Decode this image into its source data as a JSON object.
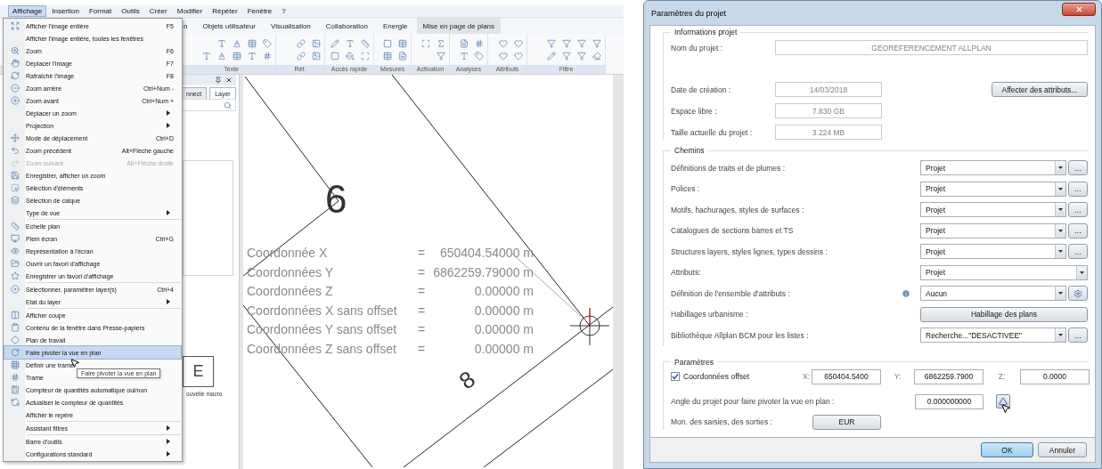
{
  "menubar": [
    {
      "label": "Affichage",
      "selected": true
    },
    {
      "label": "Insertion",
      "selected": false
    },
    {
      "label": "Format",
      "selected": false
    },
    {
      "label": "Outils",
      "selected": false
    },
    {
      "label": "Créer",
      "selected": false
    },
    {
      "label": "Modifier",
      "selected": false
    },
    {
      "label": "Répéter",
      "selected": false
    },
    {
      "label": "Fenêtre",
      "selected": false
    },
    {
      "label": "?",
      "selected": false
    }
  ],
  "ribbon": {
    "tabs": [
      {
        "label": "n",
        "selected": false
      },
      {
        "label": "Objets utilisateur",
        "selected": false
      },
      {
        "label": "Visualisation",
        "selected": false
      },
      {
        "label": "Collaboration",
        "selected": false
      },
      {
        "label": "Energie",
        "selected": false
      },
      {
        "label": "Mise en page de plans",
        "selected": true
      }
    ],
    "groups": [
      {
        "label": "Texte"
      },
      {
        "label": "Réf."
      },
      {
        "label": "Accès rapide"
      },
      {
        "label": "Mesures"
      },
      {
        "label": "Activation"
      },
      {
        "label": "Analyses"
      },
      {
        "label": "Attributs"
      },
      {
        "label": "Filtre"
      }
    ]
  },
  "menu": {
    "sections": [
      {
        "items": [
          {
            "kind": "command",
            "label": "Afficher l'image entière",
            "shortcut": "F5",
            "selected": false,
            "disabled": false
          },
          {
            "kind": "command",
            "label": "Afficher l'image entière, toutes les fenêtres",
            "selected": false,
            "disabled": false
          },
          {
            "kind": "command",
            "label": "Zoom",
            "shortcut": "F6",
            "selected": false,
            "disabled": false
          },
          {
            "kind": "command",
            "label": "Déplacer l'image",
            "shortcut": "F7",
            "selected": false,
            "disabled": false
          },
          {
            "kind": "command",
            "label": "Rafraîchir l'image",
            "shortcut": "F8",
            "selected": false,
            "disabled": false
          },
          {
            "kind": "command",
            "label": "Zoom arrière",
            "shortcut": "Ctrl+Num -",
            "selected": false,
            "disabled": false
          },
          {
            "kind": "command",
            "label": "Zoom avant",
            "shortcut": "Ctrl+Num +",
            "selected": false,
            "disabled": false
          },
          {
            "kind": "submenu",
            "label": "Déplacer un zoom",
            "selected": false,
            "disabled": false
          },
          {
            "kind": "submenu",
            "label": "Projection",
            "selected": false,
            "disabled": false
          },
          {
            "kind": "command",
            "label": "Mode de déplacement",
            "shortcut": "Ctrl+D",
            "selected": false,
            "disabled": false
          },
          {
            "kind": "command",
            "label": "Zoom précédent",
            "shortcut": "Alt+Flèche gauche",
            "selected": false,
            "disabled": false
          },
          {
            "kind": "command",
            "label": "Zoom suivant",
            "shortcut": "Alt+Flèche droite",
            "selected": false,
            "disabled": true
          },
          {
            "kind": "command",
            "label": "Enregistrer, afficher un zoom",
            "selected": false,
            "disabled": false
          },
          {
            "kind": "command",
            "label": "Sélection d'éléments",
            "selected": false,
            "disabled": false
          },
          {
            "kind": "command",
            "label": "Sélection de calque",
            "selected": false,
            "disabled": false
          },
          {
            "kind": "submenu",
            "label": "Type de vue",
            "selected": false,
            "disabled": false
          }
        ]
      },
      {
        "items": [
          {
            "kind": "command",
            "label": "Echelle plan",
            "selected": false,
            "disabled": false
          },
          {
            "kind": "command",
            "label": "Plein écran",
            "shortcut": "Ctrl+G",
            "selected": false,
            "disabled": false
          },
          {
            "kind": "command",
            "label": "Représentation à l'écran",
            "selected": false,
            "disabled": false
          },
          {
            "kind": "command",
            "label": "Ouvrir un favori d'affichage",
            "selected": false,
            "disabled": false
          },
          {
            "kind": "command",
            "label": "Enregistrer un favori d'affichage",
            "selected": false,
            "disabled": false
          }
        ]
      },
      {
        "items": [
          {
            "kind": "command",
            "label": "Sélectionner, paramétrer layer(s)",
            "shortcut": "Ctrl+4",
            "selected": false,
            "disabled": false
          },
          {
            "kind": "submenu",
            "label": "Etat du layer",
            "selected": false,
            "disabled": false
          }
        ]
      },
      {
        "items": [
          {
            "kind": "command",
            "label": "Afficher coupe",
            "selected": false,
            "disabled": false
          },
          {
            "kind": "command",
            "label": "Contenu de la fenêtre dans Presse-papiers",
            "selected": false,
            "disabled": false
          },
          {
            "kind": "command",
            "label": "Plan de travail",
            "selected": false,
            "disabled": false
          },
          {
            "kind": "command",
            "label": "Faire pivoter la vue en plan",
            "selected": true,
            "disabled": false
          },
          {
            "kind": "command",
            "label": "Définir une trame",
            "selected": false,
            "disabled": false
          },
          {
            "kind": "command",
            "label": "Trame",
            "selected": false,
            "disabled": false
          },
          {
            "kind": "command",
            "label": "Compteur de quantités automatique oui/non",
            "selected": false,
            "disabled": false
          },
          {
            "kind": "command",
            "label": "Actualiser le compteur de quantités",
            "selected": false,
            "disabled": false
          },
          {
            "kind": "command",
            "label": "Afficher le repère",
            "selected": false,
            "disabled": false
          }
        ]
      },
      {
        "items": [
          {
            "kind": "submenu",
            "label": "Assistant filtres",
            "selected": false,
            "disabled": false
          }
        ]
      },
      {
        "items": [
          {
            "kind": "submenu",
            "label": "Barre d'outils",
            "selected": false,
            "disabled": false
          },
          {
            "kind": "submenu",
            "label": "Configurations standard",
            "selected": false,
            "disabled": false
          }
        ]
      }
    ]
  },
  "tooltip": "Faire pivoter la vue en plan",
  "panel": {
    "tabs": [
      {
        "label": "nnect",
        "selected": false
      },
      {
        "label": "Layer",
        "selected": true
      }
    ],
    "macro": {
      "letter": "E",
      "caption": "ouvelle macro"
    }
  },
  "drawing": {
    "numbers": [
      "6",
      "8"
    ],
    "coordinates": [
      {
        "label": "Coordonnée X",
        "sign": "=",
        "value": "650404.54000 m"
      },
      {
        "label": "Coordonnées Y",
        "sign": "=",
        "value": "6862259.79000 m"
      },
      {
        "label": "Coordonnées Z",
        "sign": "=",
        "value": "0.00000 m"
      },
      {
        "label": "Coordonnées X sans offset",
        "sign": "=",
        "value": "0.00000 m"
      },
      {
        "label": "Coordonnées Y sans offset",
        "sign": "=",
        "value": "0.00000 m"
      },
      {
        "label": "Coordonnées Z sans offset",
        "sign": "=",
        "value": "0.00000 m"
      }
    ]
  },
  "dialog": {
    "title": "Paramètres du projet",
    "info": {
      "title": "Informations projet",
      "name_label": "Nom du projet :",
      "name_value": "GEOREFERENCEMENT ALLPLAN",
      "fields": [
        {
          "label": "Date de création :",
          "value": "14/03/2018"
        },
        {
          "label": "Espace libre :",
          "value": "7.830 GB"
        },
        {
          "label": "Taille actuelle du projet :",
          "value": "3.224 MB"
        }
      ],
      "attributes_button": "Affecter des attributs..."
    },
    "paths": {
      "title": "Chemins",
      "rows": [
        {
          "kind": "combo_browse",
          "label": "Définitions de traits et de plumes :",
          "value": "Projet",
          "button": "..."
        },
        {
          "kind": "combo_browse",
          "label": "Polices :",
          "value": "Projet",
          "button": "..."
        },
        {
          "kind": "combo_browse",
          "label": "Motifs, hachurages, styles de surfaces :",
          "value": "Projet",
          "button": "..."
        },
        {
          "kind": "combo_browse",
          "label": "Catalogues de sections barres et TS",
          "value": "Projet",
          "button": "..."
        },
        {
          "kind": "combo_browse",
          "label": "Structures layers, styles lignes, types dessins :",
          "value": "Projet",
          "button": "..."
        },
        {
          "kind": "combo",
          "label": "Attributs:",
          "value": "Projet"
        },
        {
          "kind": "combo_settings",
          "label": "Définition de l'ensemble d'attributs :",
          "value": "Aucun"
        },
        {
          "kind": "button",
          "label": "Habillages urbanisme :",
          "value": "Habillage des plans"
        },
        {
          "kind": "combo_browse",
          "label": "Bibliothèque Allplan BCM pour les listes :",
          "value": "Recherche...\"DESACTIVEE\"",
          "button": "..."
        }
      ]
    },
    "params": {
      "title": "Paramètres",
      "offset": {
        "label": "Coordonnées offset",
        "checked": true
      },
      "coords": [
        {
          "label": "X:",
          "value": "650404.5400"
        },
        {
          "label": "Y:",
          "value": "6862259.7900"
        },
        {
          "label": "Z:",
          "value": "0.0000"
        }
      ],
      "angle": {
        "label": "Angle du projet pour faire pivoter la vue en plan :",
        "value": "0.000000000"
      },
      "currency": {
        "label": "Mon. des saisies, des sorties :",
        "value": "EUR"
      }
    },
    "buttons": [
      {
        "label": "OK",
        "default": true
      },
      {
        "label": "Annuler",
        "default": false
      }
    ]
  }
}
